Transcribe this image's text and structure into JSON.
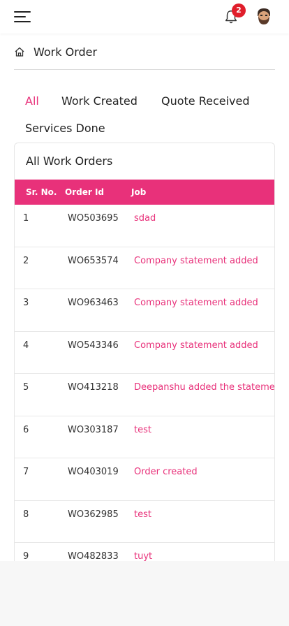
{
  "header": {
    "notification_count": "2",
    "avatar": "avatar-icon"
  },
  "breadcrumb": {
    "label": "Work Order"
  },
  "tabs": [
    {
      "label": "All",
      "active": true
    },
    {
      "label": "Work Created",
      "active": false
    },
    {
      "label": "Quote Received",
      "active": false
    },
    {
      "label": "Services Done",
      "active": false
    }
  ],
  "card": {
    "title": "All Work Orders",
    "columns": [
      "Sr. No.",
      "Order Id",
      "Job"
    ],
    "rows": [
      {
        "sr": "1",
        "order_id": "WO503695",
        "job": "sdad"
      },
      {
        "sr": "2",
        "order_id": "WO653574",
        "job": "Company statement added"
      },
      {
        "sr": "3",
        "order_id": "WO963463",
        "job": "Company statement added"
      },
      {
        "sr": "4",
        "order_id": "WO543346",
        "job": "Company statement added"
      },
      {
        "sr": "5",
        "order_id": "WO413218",
        "job": "Deepanshu added the stateme"
      },
      {
        "sr": "6",
        "order_id": "WO303187",
        "job": "test"
      },
      {
        "sr": "7",
        "order_id": "WO403019",
        "job": "Order created"
      },
      {
        "sr": "8",
        "order_id": "WO362985",
        "job": "test"
      },
      {
        "sr": "9",
        "order_id": "WO482833",
        "job": "tuyt"
      }
    ]
  },
  "colors": {
    "accent": "#e8317a",
    "badge": "#e01e2b"
  }
}
